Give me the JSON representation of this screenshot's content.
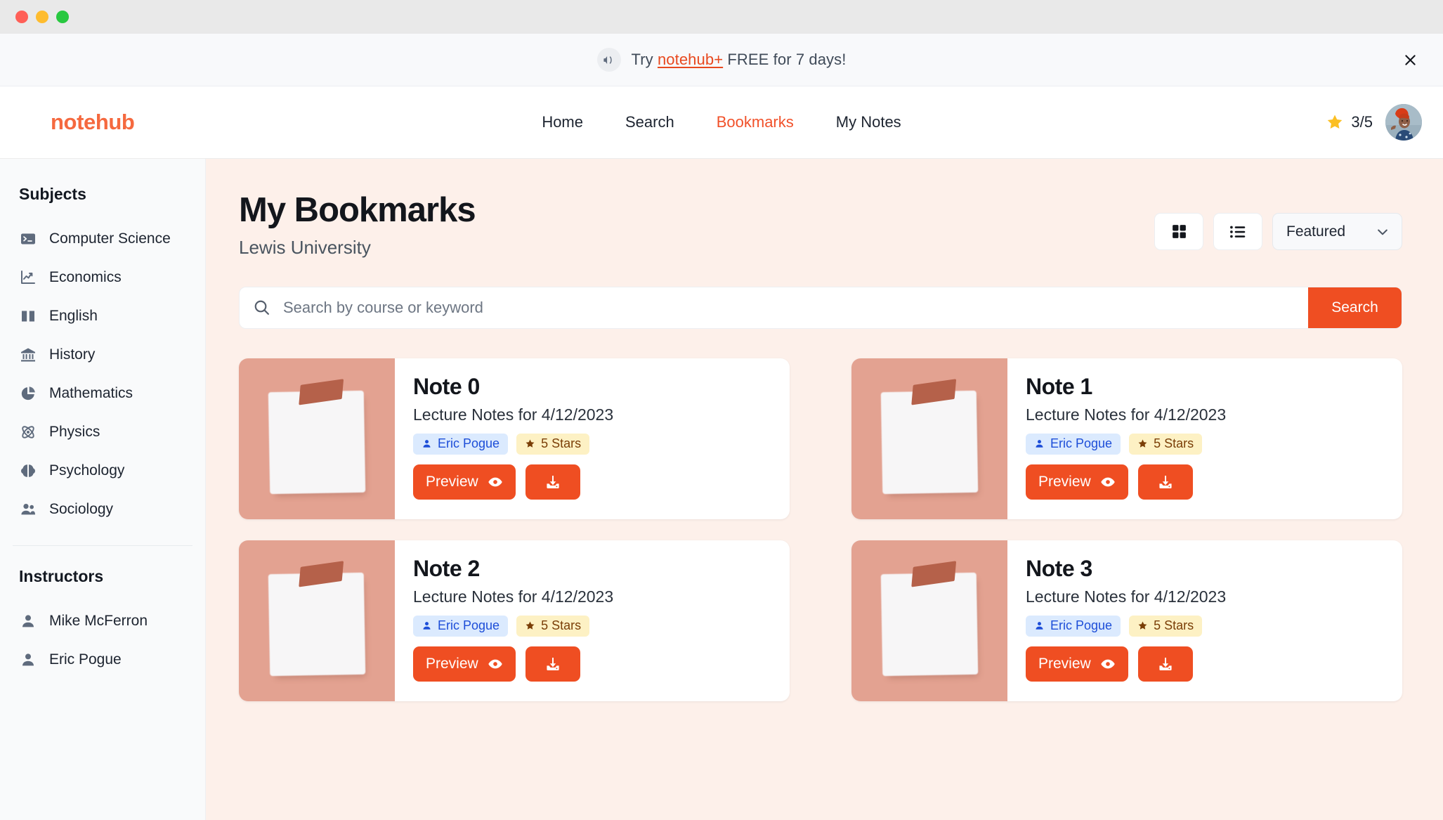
{
  "window": {
    "traffic_lights": [
      "close",
      "minimize",
      "maximize"
    ]
  },
  "promo": {
    "icon": "megaphone-icon",
    "text_before": "Try ",
    "link_label": "notehub+",
    "text_after": " FREE for 7 days!",
    "close_label": "✕"
  },
  "header": {
    "brand": "notehub",
    "brand_color": "#f5693f",
    "nav": [
      {
        "label": "Home",
        "active": false
      },
      {
        "label": "Search",
        "active": false
      },
      {
        "label": "Bookmarks",
        "active": true
      },
      {
        "label": "My Notes",
        "active": false
      }
    ],
    "rating": {
      "icon": "star-icon",
      "value": "3/5",
      "color": "#fbbf24"
    },
    "avatar": {
      "icon": "avatar",
      "alt": "user profile photo"
    }
  },
  "sidebar": {
    "subjects_heading": "Subjects",
    "subjects": [
      {
        "label": "Computer Science",
        "icon": "terminal-icon"
      },
      {
        "label": "Economics",
        "icon": "chart-line-icon"
      },
      {
        "label": "English",
        "icon": "book-open-icon"
      },
      {
        "label": "History",
        "icon": "bank-icon"
      },
      {
        "label": "Mathematics",
        "icon": "pie-chart-icon"
      },
      {
        "label": "Physics",
        "icon": "atom-icon"
      },
      {
        "label": "Psychology",
        "icon": "brain-icon"
      },
      {
        "label": "Sociology",
        "icon": "users-icon"
      }
    ],
    "instructors_heading": "Instructors",
    "instructors": [
      {
        "label": "Mike McFerron",
        "icon": "person-icon"
      },
      {
        "label": "Eric Pogue",
        "icon": "person-icon"
      }
    ]
  },
  "main": {
    "title": "My Bookmarks",
    "subtitle": "Lewis University",
    "view_grid_icon": "grid-view-icon",
    "view_list_icon": "list-view-icon",
    "sort": {
      "selected": "Featured",
      "options": [
        "Featured"
      ],
      "chevron_icon": "chevron-down-icon"
    },
    "search": {
      "icon": "search-icon",
      "value": "",
      "placeholder": "Search by course or keyword",
      "button_label": "Search"
    },
    "cards": [
      {
        "title": "Note 0",
        "subtitle": "Lecture Notes for 4/12/2023",
        "author": "Eric Pogue",
        "author_icon": "person-icon",
        "rating": "5 Stars",
        "rating_icon": "star-icon",
        "preview_label": "Preview",
        "preview_icon": "eye-icon",
        "download_icon": "download-icon",
        "thumb_icon": "torn-paper-thumbnail"
      },
      {
        "title": "Note 1",
        "subtitle": "Lecture Notes for 4/12/2023",
        "author": "Eric Pogue",
        "author_icon": "person-icon",
        "rating": "5 Stars",
        "rating_icon": "star-icon",
        "preview_label": "Preview",
        "preview_icon": "eye-icon",
        "download_icon": "download-icon",
        "thumb_icon": "torn-paper-thumbnail"
      },
      {
        "title": "Note 2",
        "subtitle": "Lecture Notes for 4/12/2023",
        "author": "Eric Pogue",
        "author_icon": "person-icon",
        "rating": "5 Stars",
        "rating_icon": "star-icon",
        "preview_label": "Preview",
        "preview_icon": "eye-icon",
        "download_icon": "download-icon",
        "thumb_icon": "torn-paper-thumbnail"
      },
      {
        "title": "Note 3",
        "subtitle": "Lecture Notes for 4/12/2023",
        "author": "Eric Pogue",
        "author_icon": "person-icon",
        "rating": "5 Stars",
        "rating_icon": "star-icon",
        "preview_label": "Preview",
        "preview_icon": "eye-icon",
        "download_icon": "download-icon",
        "thumb_icon": "torn-paper-thumbnail"
      }
    ]
  },
  "colors": {
    "accent": "#ef4e22",
    "brand": "#f5693f",
    "main_bg": "#fdf0ea",
    "sidebar_bg": "#f9fafb",
    "thumb_bg": "#e3a291",
    "badge_author_bg": "#dbeafe",
    "badge_rating_bg": "#fdf1c4",
    "star": "#fbbf24"
  }
}
